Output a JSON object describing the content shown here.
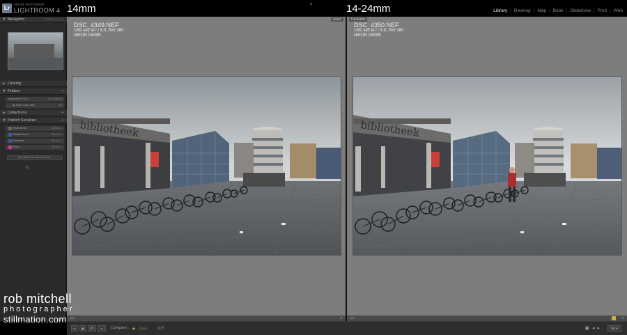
{
  "app": {
    "adobe_label": "ADOBE PHOTOSHOP",
    "title": "LIGHTROOM 4",
    "logo": "Lr"
  },
  "overlay": {
    "left_label": "14mm",
    "right_label": "14-24mm"
  },
  "modules": [
    {
      "label": "Library",
      "active": true
    },
    {
      "label": "Develop",
      "active": false
    },
    {
      "label": "Map",
      "active": false
    },
    {
      "label": "Book",
      "active": false
    },
    {
      "label": "Slideshow",
      "active": false
    },
    {
      "label": "Print",
      "active": false
    },
    {
      "label": "Web",
      "active": false
    }
  ],
  "left_panel": {
    "navigator": {
      "label": "Navigator",
      "modes": "FIT  FILL  1:1  3:1"
    },
    "catalog": {
      "label": "Catalog"
    },
    "folders": {
      "label": "Folders",
      "drive": {
        "name": "Lexar(w/n)P (S:)",
        "space": "6.5 / 465GB"
      },
      "folder": {
        "name": "14mm lens test",
        "count": "26"
      }
    },
    "collections": {
      "label": "Collections"
    },
    "publish": {
      "label": "Publish Services",
      "services": [
        {
          "name": "Hard Drive",
          "action": "Set Up..."
        },
        {
          "name": "Adobe Revel",
          "action": "Set Up..."
        },
        {
          "name": "Facebook",
          "action": "Set Up..."
        },
        {
          "name": "Flickr",
          "action": "Set Up..."
        }
      ],
      "find_more": "Find More Services Online..."
    }
  },
  "compare": {
    "select": {
      "tag": "Select",
      "filename": "DSC_4349.NEF",
      "exposure": "1/80 sec at f / 8.0, ISO 160",
      "camera": "NIKON D800E"
    },
    "candidate": {
      "tag": "Candidate",
      "filename": "DSC_4350.NEF",
      "exposure": "1/80 sec at f / 8.0, ISO 160",
      "camera": "NIKON D800E"
    }
  },
  "toolbar": {
    "compare_label": "Compare :",
    "sync_label": "Zoom",
    "swap_label": "X|Y",
    "done_label": "Done",
    "view_buttons": [
      "▭",
      "▦",
      "XY",
      "▭"
    ]
  },
  "watermark": {
    "name": "rob mitchell",
    "title": "photographer",
    "site": "stillmation.com"
  },
  "colors": {
    "pane_bg": "#7d7d7d",
    "panel_bg": "#2a2a2a",
    "accent": "#c8b23a"
  }
}
